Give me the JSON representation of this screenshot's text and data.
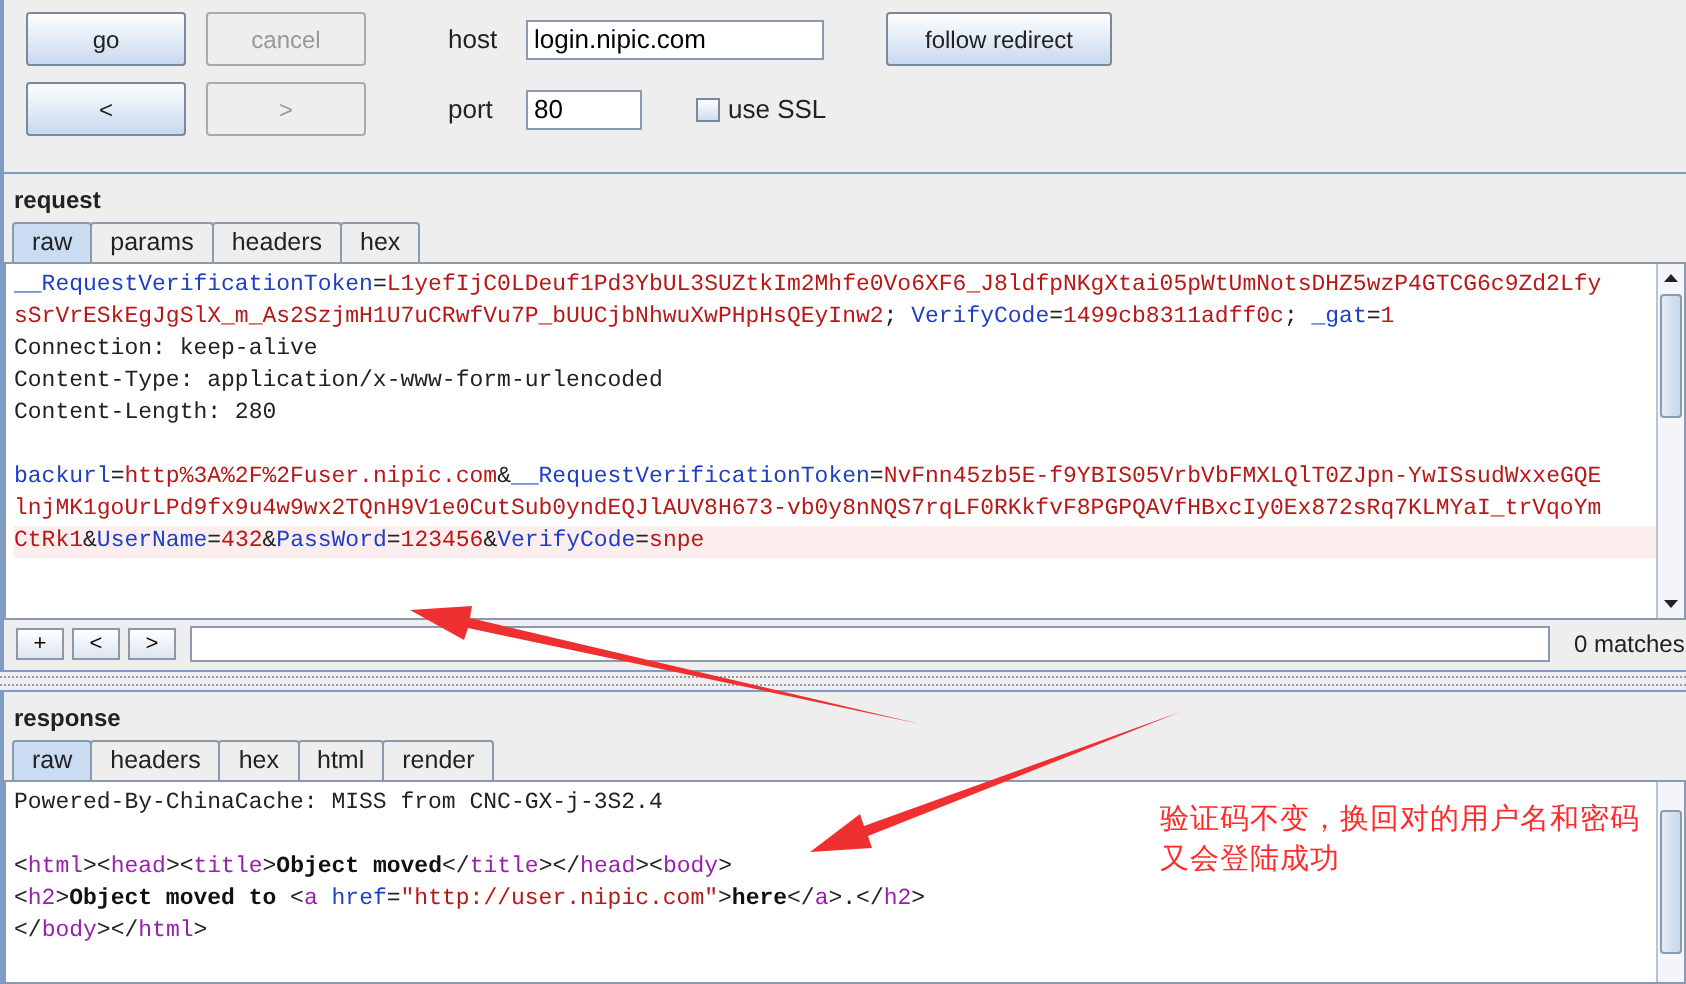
{
  "toolbar": {
    "buttons": [
      {
        "label": "go",
        "disabled": false
      },
      {
        "label": "cancel",
        "disabled": true
      },
      {
        "label": "<",
        "disabled": false
      },
      {
        "label": ">",
        "disabled": true
      }
    ],
    "host": {
      "label": "host",
      "value": "login.nipic.com"
    },
    "port": {
      "label": "port",
      "value": "80"
    },
    "follow_button": {
      "label": "follow redirect"
    },
    "use_ssl": {
      "label": "use SSL",
      "checked": false
    }
  },
  "request": {
    "title": "request",
    "tabs": [
      {
        "label": "raw",
        "selected": true
      },
      {
        "label": "params",
        "selected": false
      },
      {
        "label": "headers",
        "selected": false
      },
      {
        "label": "hex",
        "selected": false
      }
    ],
    "lines": [
      {
        "kind": "code",
        "highlighted": false,
        "segments": [
          {
            "kind": "key",
            "text": "__RequestVerificationToken"
          },
          {
            "kind": "plain",
            "text": "="
          },
          {
            "kind": "value",
            "text": "L1yefIjC0LDeuf1Pd3YbUL3SUZtkIm2Mhfe0Vo6XF6_J8ldfpNKgXtai05pWtUmNotsDHZ5wzP4GTCG6c9Zd2Lfy"
          }
        ]
      },
      {
        "kind": "code",
        "highlighted": false,
        "segments": [
          {
            "kind": "value",
            "text": "sSrVrESkEgJgSlX_m_As2SzjmH1U7uCRwfVu7P_bUUCjbNhwuXwPHpHsQEyInw2"
          },
          {
            "kind": "plain",
            "text": "; "
          },
          {
            "kind": "key",
            "text": "VerifyCode"
          },
          {
            "kind": "plain",
            "text": "="
          },
          {
            "kind": "value",
            "text": "1499cb8311adff0c"
          },
          {
            "kind": "plain",
            "text": "; "
          },
          {
            "kind": "key",
            "text": "_gat"
          },
          {
            "kind": "plain",
            "text": "="
          },
          {
            "kind": "value",
            "text": "1"
          }
        ]
      },
      {
        "kind": "code",
        "highlighted": false,
        "segments": [
          {
            "kind": "plain",
            "text": "Connection: keep-alive"
          }
        ]
      },
      {
        "kind": "code",
        "highlighted": false,
        "segments": [
          {
            "kind": "plain",
            "text": "Content-Type: application/x-www-form-urlencoded"
          }
        ]
      },
      {
        "kind": "code",
        "highlighted": false,
        "segments": [
          {
            "kind": "plain",
            "text": "Content-Length: 280"
          }
        ]
      },
      {
        "kind": "blank"
      },
      {
        "kind": "code",
        "highlighted": false,
        "segments": [
          {
            "kind": "key",
            "text": "backurl"
          },
          {
            "kind": "plain",
            "text": "="
          },
          {
            "kind": "value",
            "text": "http%3A%2F%2Fuser.nipic.com"
          },
          {
            "kind": "plain",
            "text": "&"
          },
          {
            "kind": "key",
            "text": "__RequestVerificationToken"
          },
          {
            "kind": "plain",
            "text": "="
          },
          {
            "kind": "value",
            "text": "NvFnn45zb5E-f9YBIS05VrbVbFMXLQlT0ZJpn-YwISsudWxxeGQE"
          }
        ]
      },
      {
        "kind": "code",
        "highlighted": false,
        "segments": [
          {
            "kind": "value",
            "text": "lnjMK1goUrLPd9fx9u4w9wx2TQnH9V1e0CutSub0yndEQJlAUV8H673-vb0y8nNQS7rqLF0RKkfvF8PGPQAVfHBxcIy0Ex872sRq7KLMYaI_trVqoYm"
          }
        ]
      },
      {
        "kind": "code",
        "highlighted": true,
        "segments": [
          {
            "kind": "value",
            "text": "CtRk1"
          },
          {
            "kind": "plain",
            "text": "&"
          },
          {
            "kind": "key",
            "text": "UserName"
          },
          {
            "kind": "plain",
            "text": "="
          },
          {
            "kind": "value",
            "text": "432"
          },
          {
            "kind": "plain",
            "text": "&"
          },
          {
            "kind": "key",
            "text": "PassWord"
          },
          {
            "kind": "plain",
            "text": "="
          },
          {
            "kind": "value",
            "text": "123456"
          },
          {
            "kind": "plain",
            "text": "&"
          },
          {
            "kind": "key",
            "text": "VerifyCode"
          },
          {
            "kind": "plain",
            "text": "="
          },
          {
            "kind": "value",
            "text": "snpe"
          }
        ]
      }
    ],
    "find_bar": {
      "buttons": [
        "+",
        "<",
        ">"
      ],
      "status": "0 matches"
    }
  },
  "response": {
    "title": "response",
    "tabs": [
      {
        "label": "raw",
        "selected": true
      },
      {
        "label": "headers",
        "selected": false
      },
      {
        "label": "hex",
        "selected": false
      },
      {
        "label": "html",
        "selected": false
      },
      {
        "label": "render",
        "selected": false
      }
    ],
    "lines": [
      {
        "kind": "code",
        "highlighted": false,
        "segments": [
          {
            "kind": "plain",
            "text": "Powered-By-ChinaCache: MISS from CNC-GX-j-3S2.4"
          }
        ]
      },
      {
        "kind": "blank"
      },
      {
        "kind": "code",
        "highlighted": false,
        "segments": [
          {
            "kind": "plain",
            "text": "<"
          },
          {
            "kind": "tag",
            "text": "html"
          },
          {
            "kind": "plain",
            "text": "><"
          },
          {
            "kind": "tag",
            "text": "head"
          },
          {
            "kind": "plain",
            "text": "><"
          },
          {
            "kind": "tag",
            "text": "title"
          },
          {
            "kind": "plain",
            "text": ">"
          },
          {
            "kind": "bold",
            "text": "Object moved"
          },
          {
            "kind": "plain",
            "text": "</"
          },
          {
            "kind": "tag",
            "text": "title"
          },
          {
            "kind": "plain",
            "text": "></"
          },
          {
            "kind": "tag",
            "text": "head"
          },
          {
            "kind": "plain",
            "text": "><"
          },
          {
            "kind": "tag",
            "text": "body"
          },
          {
            "kind": "plain",
            "text": ">"
          }
        ]
      },
      {
        "kind": "code",
        "highlighted": false,
        "segments": [
          {
            "kind": "plain",
            "text": "<"
          },
          {
            "kind": "tag",
            "text": "h2"
          },
          {
            "kind": "plain",
            "text": ">"
          },
          {
            "kind": "bold",
            "text": "Object moved to "
          },
          {
            "kind": "plain",
            "text": "<"
          },
          {
            "kind": "tag",
            "text": "a"
          },
          {
            "kind": "key",
            "text": " href"
          },
          {
            "kind": "plain",
            "text": "="
          },
          {
            "kind": "value",
            "text": "\"http://user.nipic.com\""
          },
          {
            "kind": "plain",
            "text": ">"
          },
          {
            "kind": "bold",
            "text": "here"
          },
          {
            "kind": "plain",
            "text": "</"
          },
          {
            "kind": "tag",
            "text": "a"
          },
          {
            "kind": "plain",
            "text": ">.</"
          },
          {
            "kind": "tag",
            "text": "h2"
          },
          {
            "kind": "plain",
            "text": ">"
          }
        ]
      },
      {
        "kind": "code",
        "highlighted": false,
        "segments": [
          {
            "kind": "plain",
            "text": "</"
          },
          {
            "kind": "tag",
            "text": "body"
          },
          {
            "kind": "plain",
            "text": "></"
          },
          {
            "kind": "tag",
            "text": "html"
          },
          {
            "kind": "plain",
            "text": ">"
          }
        ]
      }
    ]
  },
  "annotation": {
    "lines": [
      "验证码不变，换回对的用户名和密码",
      "又会登陆成功"
    ]
  }
}
